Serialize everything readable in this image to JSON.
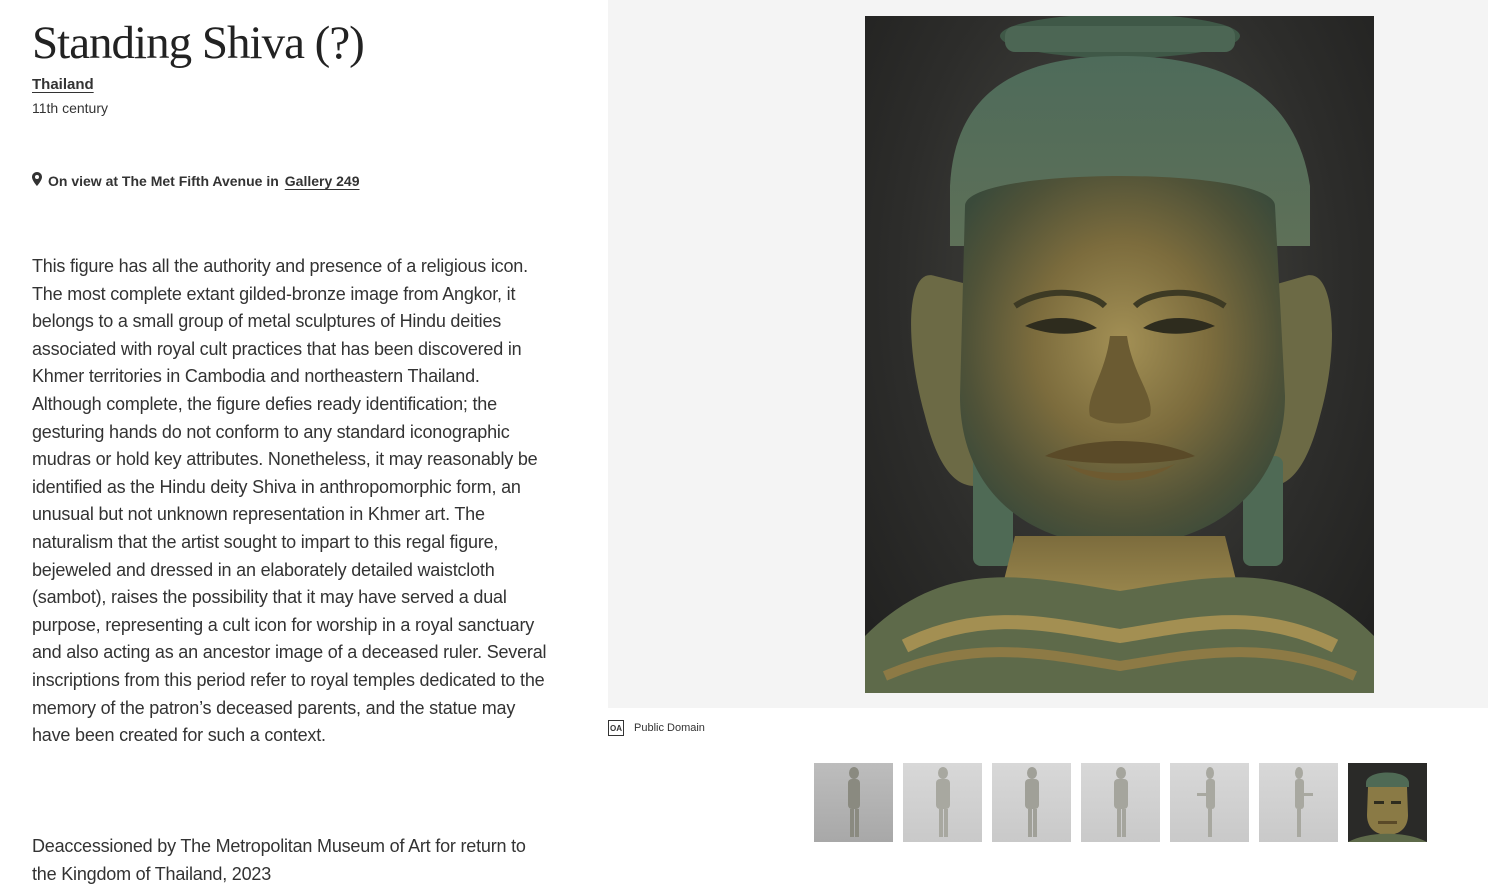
{
  "artwork": {
    "title": "Standing Shiva (?)",
    "culture": "Thailand",
    "date": "11th century"
  },
  "location": {
    "prefix": "On view at The Met Fifth Avenue in",
    "gallery": "Gallery 249"
  },
  "description": "This figure has all the authority and presence of a religious icon. The most complete extant gilded-bronze image from Angkor, it belongs to a small group of metal sculptures of Hindu deities associated with royal cult practices that has been discovered in Khmer territories in Cambodia and northeastern Thailand. Although complete, the figure defies ready identification; the gesturing hands do not conform to any standard iconographic mudras or hold key attributes. Nonetheless, it may reasonably be identified as the Hindu deity Shiva in anthropomorphic form, an unusual but not unknown representation in Khmer art. The naturalism that the artist sought to impart to this regal figure, bejeweled and dressed in an elaborately detailed waistcloth (sambot), raises the possibility that it may have served a dual purpose, representing a cult icon for worship in a royal sanctuary and also acting as an ancestor image of a deceased ruler. Several inscriptions from this period refer to royal temples dedicated to the memory of the patron’s deceased parents, and the statue may have been created for such a context.",
  "deaccession": "Deaccessioned by The Metropolitan Museum of Art for return to the Kingdom of Thailand, 2023",
  "license": {
    "badge": "OA",
    "label": "Public Domain"
  },
  "thumbnails": [
    {
      "icon": "standing-figure-front"
    },
    {
      "icon": "standing-figure-front-light"
    },
    {
      "icon": "standing-figure-front-light"
    },
    {
      "icon": "standing-figure-back"
    },
    {
      "icon": "standing-figure-side"
    },
    {
      "icon": "standing-figure-side"
    },
    {
      "icon": "head-closeup",
      "active": true
    }
  ],
  "colors": {
    "text": "#333333",
    "viewer_bg": "#f4f4f4",
    "bronze": "#8a7a45",
    "patina": "#4f6a55"
  }
}
